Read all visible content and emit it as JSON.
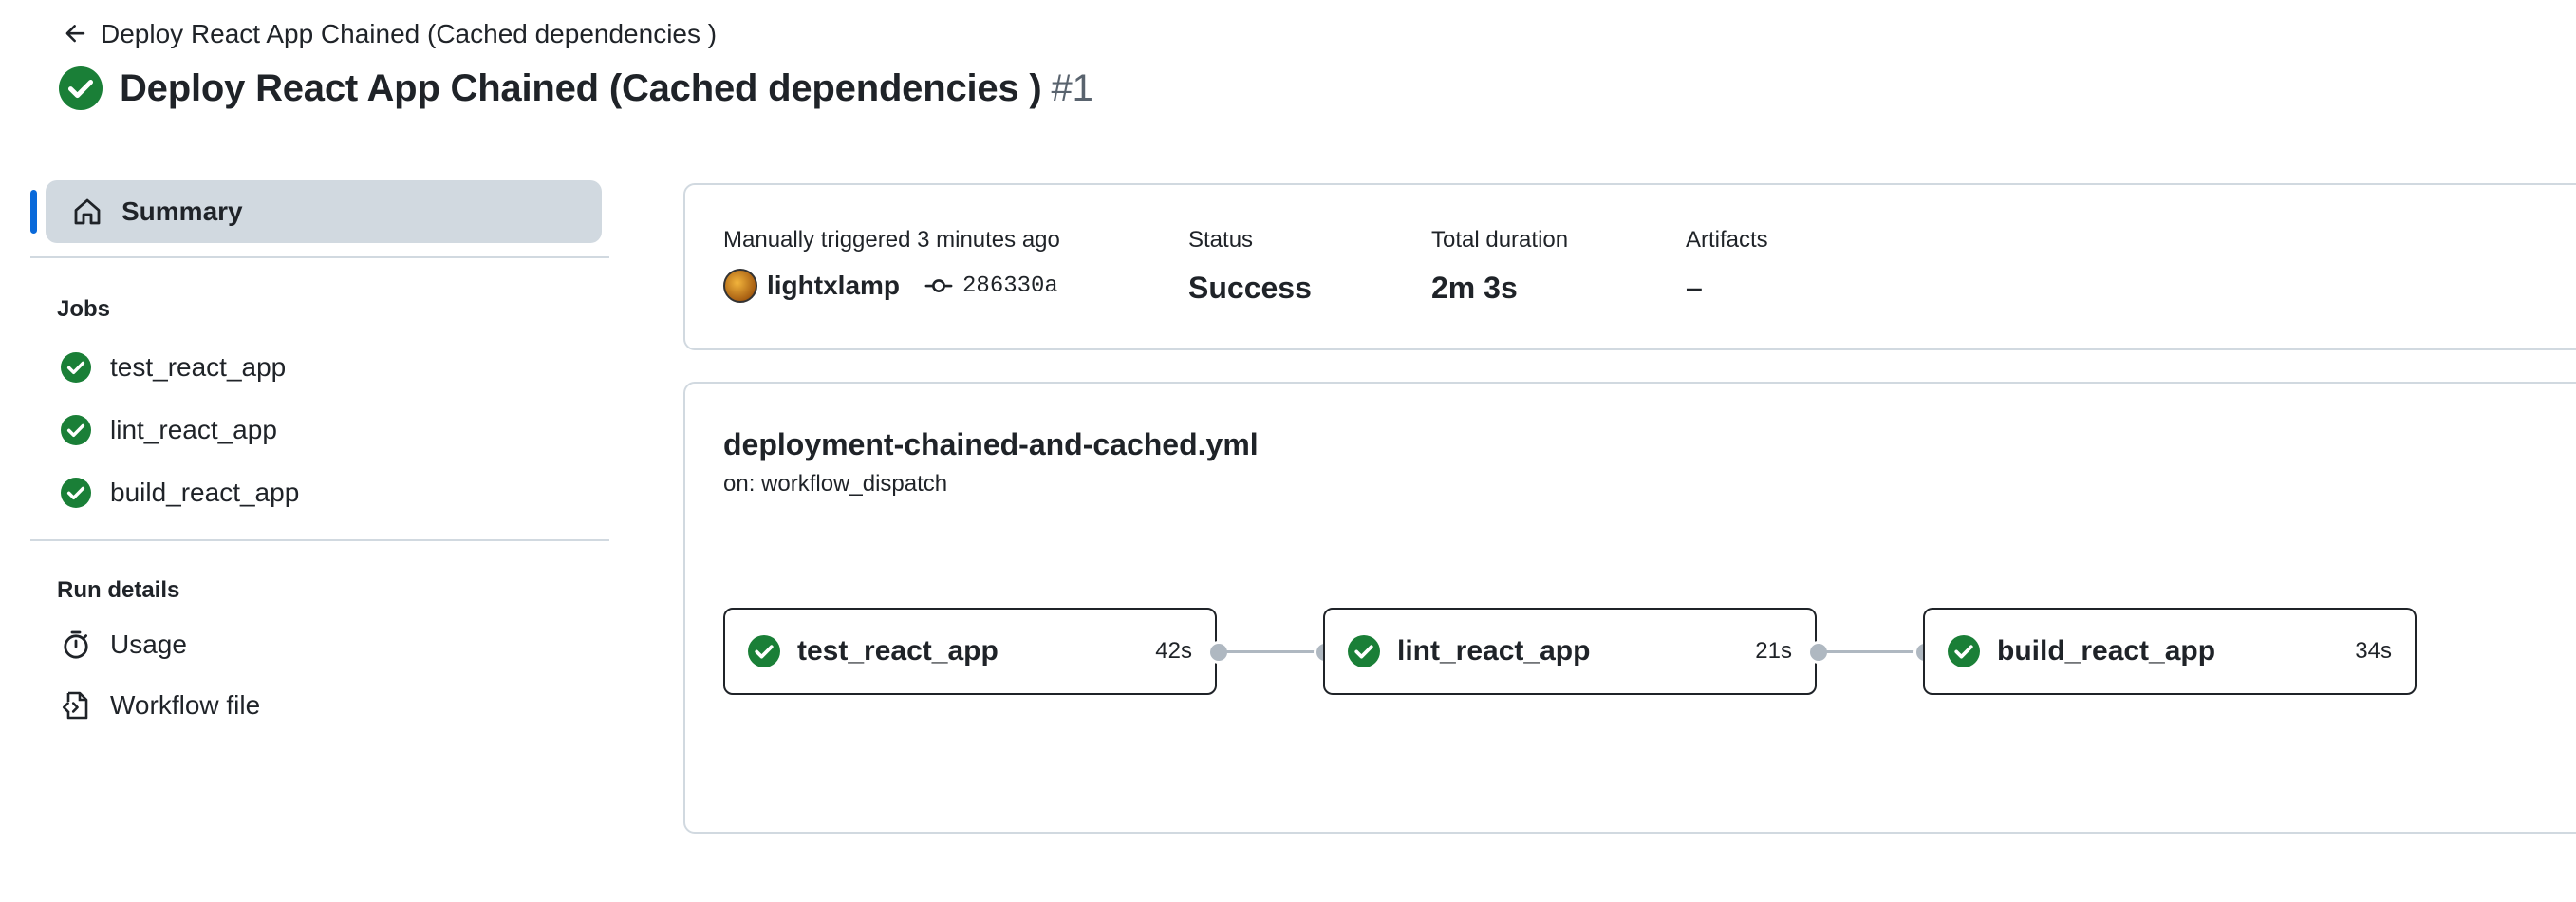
{
  "header": {
    "back_label": "Deploy React App Chained (Cached dependencies )",
    "title": "Deploy React App Chained (Cached dependencies )",
    "run_number": "#1"
  },
  "sidebar": {
    "summary_label": "Summary",
    "jobs_heading": "Jobs",
    "jobs": [
      {
        "label": "test_react_app",
        "icon": "success-check-icon"
      },
      {
        "label": "lint_react_app",
        "icon": "success-check-icon"
      },
      {
        "label": "build_react_app",
        "icon": "success-check-icon"
      }
    ],
    "run_details_heading": "Run details",
    "run_details": [
      {
        "label": "Usage",
        "icon": "stopwatch-icon"
      },
      {
        "label": "Workflow file",
        "icon": "file-code-icon"
      }
    ]
  },
  "summary": {
    "trigger_label": "Manually triggered 3 minutes ago",
    "actor": "lightxlamp",
    "commit": "286330a",
    "status_label": "Status",
    "status_value": "Success",
    "duration_label": "Total duration",
    "duration_value": "2m 3s",
    "artifacts_label": "Artifacts",
    "artifacts_value": "–"
  },
  "workflow": {
    "file": "deployment-chained-and-cached.yml",
    "trigger": "on: workflow_dispatch",
    "jobs": [
      {
        "name": "test_react_app",
        "duration": "42s"
      },
      {
        "name": "lint_react_app",
        "duration": "21s"
      },
      {
        "name": "build_react_app",
        "duration": "34s"
      }
    ]
  },
  "colors": {
    "success": "#1a7f37",
    "accent": "#0969da",
    "selected_bg": "#d1d9e0",
    "border": "#d1d9e0"
  }
}
